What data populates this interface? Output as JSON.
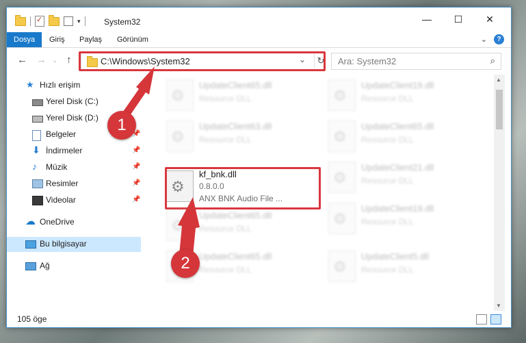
{
  "window": {
    "title": "System32"
  },
  "ribbon": {
    "tabs": [
      {
        "label": "Dosya",
        "active": true
      },
      {
        "label": "Giriş"
      },
      {
        "label": "Paylaş"
      },
      {
        "label": "Görünüm"
      }
    ]
  },
  "address": {
    "path": "C:\\Windows\\System32"
  },
  "search": {
    "placeholder": "Ara: System32"
  },
  "sidebar": {
    "items": [
      {
        "label": "Hızlı erişim",
        "icon": "star-icon"
      },
      {
        "label": "Yerel Disk (C:)",
        "icon": "drive-icon"
      },
      {
        "label": "Yerel Disk (D:)",
        "icon": "drive-icon"
      },
      {
        "label": "Belgeler",
        "icon": "documents-icon",
        "pinned": true
      },
      {
        "label": "İndirmeler",
        "icon": "download-icon",
        "pinned": true
      },
      {
        "label": "Müzik",
        "icon": "music-icon",
        "pinned": true
      },
      {
        "label": "Resimler",
        "icon": "pictures-icon",
        "pinned": true
      },
      {
        "label": "Videolar",
        "icon": "videos-icon",
        "pinned": true
      },
      {
        "label": "OneDrive",
        "icon": "cloud-icon"
      },
      {
        "label": "Bu bilgisayar",
        "icon": "computer-icon",
        "selected": true
      },
      {
        "label": "Ağ",
        "icon": "network-icon"
      }
    ]
  },
  "files": [
    {
      "name": "UpdateClient65.dll",
      "type": "Resource DLL"
    },
    {
      "name": "UpdateClient19.dll",
      "type": "Resource DLL"
    },
    {
      "name": "UpdateClient63.dll",
      "type": "Resource DLL"
    },
    {
      "name": "UpdateClient65.dll",
      "type": "Resource DLL"
    },
    {
      "name": "UpdateClient21.dll",
      "type": "Resource DLL"
    },
    {
      "name": "UpdateClient65.dll",
      "type": "Resource DLL"
    },
    {
      "name": "UpdateClient19.dll",
      "type": "Resource DLL"
    },
    {
      "name": "UpdateClient65.dll",
      "type": "Resource DLL"
    },
    {
      "name": "UpdateClient5.dll",
      "type": "Resource DLL"
    }
  ],
  "highlighted_file": {
    "name": "kf_bnk.dll",
    "version": "0.8.0.0",
    "description": "ANX BNK Audio File ..."
  },
  "status": {
    "count": "105 öge"
  },
  "markers": [
    "1",
    "2"
  ],
  "colors": {
    "accent": "#1979ca",
    "highlight": "#d9363e",
    "selection": "#cce8ff"
  }
}
